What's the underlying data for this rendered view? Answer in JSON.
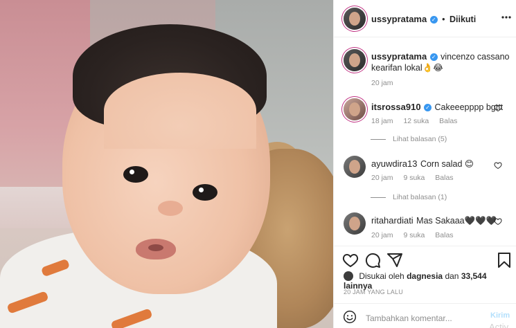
{
  "colors": {
    "accent": "#3897f0",
    "muted": "#8e8e8e",
    "text": "#262626",
    "border": "#efefef"
  },
  "header": {
    "username": "ussypratama",
    "dot": "•",
    "follow_status": "Diikuti",
    "more_icon": "more-icon"
  },
  "caption": {
    "username": "ussypratama",
    "text": "vincenzo cassano kearifan lokal👌😂",
    "time": "20 jam"
  },
  "comments": [
    {
      "username": "itsrossa910",
      "verified": true,
      "text": "Cakeeepppp bgttt",
      "time": "18 jam",
      "likes": "12 suka",
      "reply": "Balas",
      "view_replies": "Lihat balasan (5)"
    },
    {
      "username": "ayuwdira13",
      "verified": false,
      "text": "Corn salad 😊",
      "time": "20 jam",
      "likes": "9 suka",
      "reply": "Balas",
      "view_replies": "Lihat balasan (1)"
    },
    {
      "username": "ritahardiati",
      "verified": false,
      "text": "Mas Sakaaa🖤🖤🖤",
      "time": "20 jam",
      "likes": "9 suka",
      "reply": "Balas",
      "view_replies": ""
    }
  ],
  "actions": {
    "like_icon": "heart-icon",
    "comment_icon": "comment-icon",
    "share_icon": "share-icon",
    "save_icon": "bookmark-icon"
  },
  "likes": {
    "prefix": "Disukai oleh",
    "user": "dagnesia",
    "joiner": "dan",
    "count": "33,544 lainnya"
  },
  "posted": "20 JAM YANG LALU",
  "add_comment": {
    "placeholder": "Tambahkan komentar...",
    "post_label": "Kirim",
    "overlay": "Activ"
  }
}
